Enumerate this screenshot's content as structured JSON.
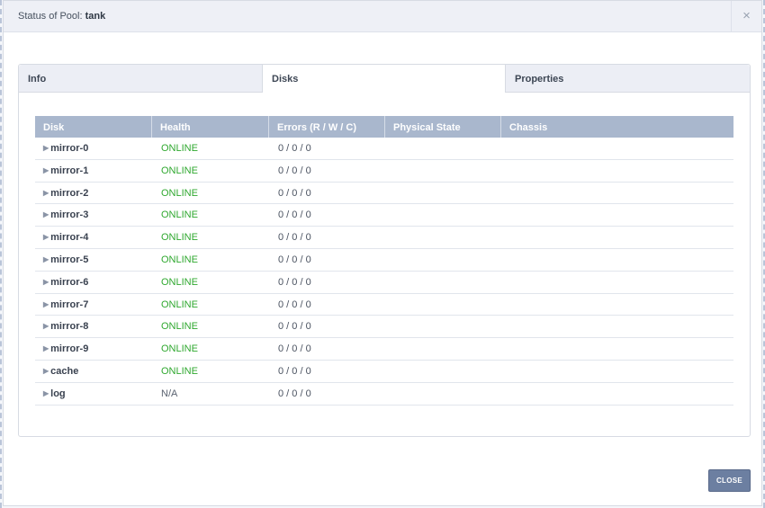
{
  "dialog": {
    "title_prefix": "Status of Pool:",
    "title_pool": "tank",
    "close_glyph": "×",
    "close_button_label": "CLOSE"
  },
  "tabs": [
    {
      "label": "Info",
      "active": false
    },
    {
      "label": "Disks",
      "active": true
    },
    {
      "label": "Properties",
      "active": false
    }
  ],
  "grid": {
    "columns": [
      "Disk",
      "Health",
      "Errors (R / W / C)",
      "Physical State",
      "Chassis"
    ],
    "rows": [
      {
        "disk": "mirror-0",
        "health": "ONLINE",
        "errors": "0 / 0 / 0",
        "physical_state": "",
        "chassis": ""
      },
      {
        "disk": "mirror-1",
        "health": "ONLINE",
        "errors": "0 / 0 / 0",
        "physical_state": "",
        "chassis": ""
      },
      {
        "disk": "mirror-2",
        "health": "ONLINE",
        "errors": "0 / 0 / 0",
        "physical_state": "",
        "chassis": ""
      },
      {
        "disk": "mirror-3",
        "health": "ONLINE",
        "errors": "0 / 0 / 0",
        "physical_state": "",
        "chassis": ""
      },
      {
        "disk": "mirror-4",
        "health": "ONLINE",
        "errors": "0 / 0 / 0",
        "physical_state": "",
        "chassis": ""
      },
      {
        "disk": "mirror-5",
        "health": "ONLINE",
        "errors": "0 / 0 / 0",
        "physical_state": "",
        "chassis": ""
      },
      {
        "disk": "mirror-6",
        "health": "ONLINE",
        "errors": "0 / 0 / 0",
        "physical_state": "",
        "chassis": ""
      },
      {
        "disk": "mirror-7",
        "health": "ONLINE",
        "errors": "0 / 0 / 0",
        "physical_state": "",
        "chassis": ""
      },
      {
        "disk": "mirror-8",
        "health": "ONLINE",
        "errors": "0 / 0 / 0",
        "physical_state": "",
        "chassis": ""
      },
      {
        "disk": "mirror-9",
        "health": "ONLINE",
        "errors": "0 / 0 / 0",
        "physical_state": "",
        "chassis": ""
      },
      {
        "disk": "cache",
        "health": "ONLINE",
        "errors": "0 / 0 / 0",
        "physical_state": "",
        "chassis": ""
      },
      {
        "disk": "log",
        "health": "N/A",
        "errors": "0 / 0 / 0",
        "physical_state": "",
        "chassis": ""
      }
    ]
  },
  "icons": {
    "expand": "expand-arrow-icon",
    "close": "close-icon"
  },
  "colors": {
    "online": "#2fa82f",
    "na": "#5a6270",
    "header_bg": "#a9b7cd",
    "button_bg": "#6c7fa1"
  }
}
